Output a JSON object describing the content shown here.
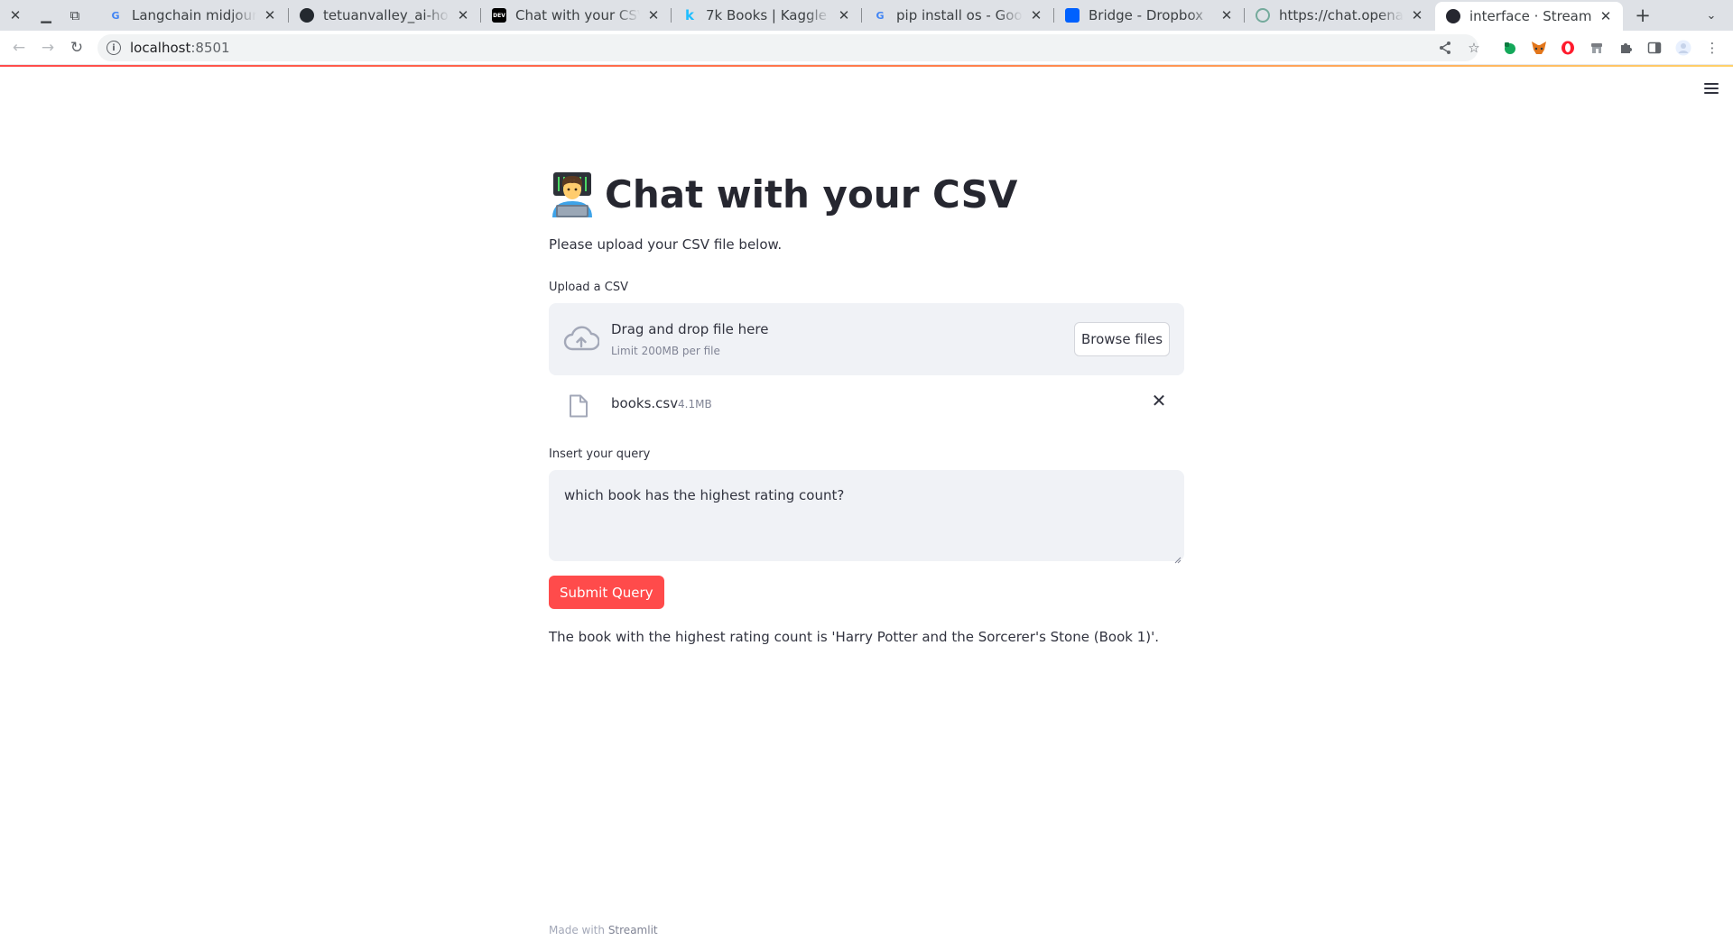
{
  "browser": {
    "tabs": [
      {
        "title": "Langchain midjourney",
        "favicon": "google-g"
      },
      {
        "title": "tetuanvalley_ai-home",
        "favicon": "github"
      },
      {
        "title": "Chat with your CSV: V",
        "favicon": "dev-to"
      },
      {
        "title": "7k Books | Kaggle",
        "favicon": "kaggle-k"
      },
      {
        "title": "pip install os - Google",
        "favicon": "google-g"
      },
      {
        "title": "Bridge - Dropbox",
        "favicon": "dropbox"
      },
      {
        "title": "https://chat.openai.c",
        "favicon": "openai"
      },
      {
        "title": "interface · Streamlit",
        "favicon": "streamlit",
        "active": true
      }
    ],
    "favicon_text": {
      "google": "G",
      "dev": "DEV",
      "kaggle": "k"
    },
    "url": "localhost:8501",
    "url_host": "localhost",
    "url_port": ":8501"
  },
  "app": {
    "title": "Chat with your CSV",
    "title_icon": "technologist-emoji",
    "subtitle": "Please upload your CSV file below.",
    "uploader": {
      "label": "Upload a CSV",
      "dropzone_title": "Drag and drop file here",
      "limit_text": "Limit 200MB per file",
      "browse_label": "Browse files",
      "file": {
        "name": "books.csv",
        "size": "4.1MB"
      }
    },
    "query": {
      "label": "Insert your query",
      "value": "which book has the highest rating count?"
    },
    "submit_label": "Submit Query",
    "answer": "The book with the highest rating count is 'Harry Potter and the Sorcerer's Stone (Book 1)'.",
    "footer": {
      "prefix": "Made with",
      "brand": "Streamlit"
    }
  },
  "colors": {
    "primary": "#ff4b4b",
    "text": "#31333f",
    "input_bg": "#f0f2f6",
    "muted": "#808495"
  }
}
